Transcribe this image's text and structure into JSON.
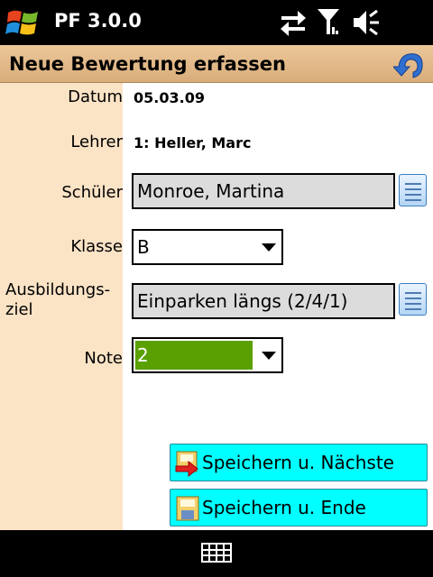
{
  "statusbar": {
    "app_title": "PF 3.0.0",
    "icons": [
      "windows-start-icon",
      "sync-icon",
      "signal-icon",
      "speaker-icon"
    ]
  },
  "titlebar": {
    "title": "Neue Bewertung erfassen",
    "back_icon": "back-arrow-icon"
  },
  "form": {
    "datum": {
      "label": "Datum",
      "value": "05.03.09"
    },
    "lehrer": {
      "label": "Lehrer",
      "value": "1: Heller, Marc"
    },
    "schueler": {
      "label": "Schüler",
      "value": "Monroe, Martina"
    },
    "klasse": {
      "label": "Klasse",
      "value": "B"
    },
    "ausbildungsziel": {
      "label_line1": "Ausbildungs-",
      "label_line2": "ziel",
      "value": "Einparken längs (2/4/1)"
    },
    "note": {
      "label": "Note",
      "value": "2"
    }
  },
  "actions": {
    "save_next": "Speichern u. Nächste",
    "save_end": "Speichern u. Ende"
  },
  "bottombar": {
    "icon": "keyboard-icon"
  },
  "colors": {
    "titlebar": "#d9ad7a",
    "label_column": "#fbe3c6",
    "action_button": "#00ffff",
    "note_highlight": "#5aa000"
  }
}
